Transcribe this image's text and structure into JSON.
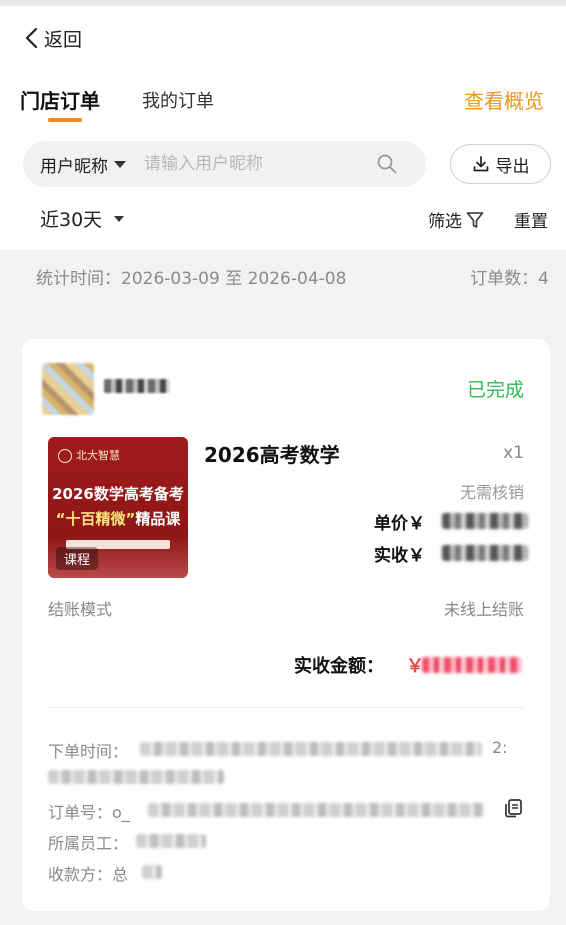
{
  "nav": {
    "back_label": "返回"
  },
  "tabs": {
    "store_orders": "门店订单",
    "my_orders": "我的订单",
    "overview": "查看概览"
  },
  "search": {
    "field_select": "用户昵称",
    "placeholder": "请输入用户昵称"
  },
  "toolbar": {
    "export_label": "导出",
    "date_range": "近30天",
    "filter_label": "筛选",
    "reset_label": "重置"
  },
  "stats": {
    "time_text": "统计时间：2026-03-09 至 2026-04-08",
    "count_text": "订单数：4"
  },
  "order": {
    "status": "已完成",
    "cover": {
      "publisher": "北大智慧",
      "line1": "2026数学高考备考",
      "line2_quote": "“十百精微”",
      "line2_rest": "精品课",
      "badge": "课程"
    },
    "product_title": "2026高考数学",
    "quantity": "x1",
    "verify_status": "无需核销",
    "unit_price_label": "单价￥",
    "paid_label": "实收￥",
    "checkout_mode_label": "结账模式",
    "checkout_mode_value": "未线上结账",
    "total_label": "实收金额：",
    "total_currency": "￥",
    "order_time_label": "下单时间：",
    "order_time_tail": "2:",
    "order_no_label": "订单号：o_",
    "staff_label": "所属员工：",
    "payee_label": "收款方：总"
  },
  "icons": {
    "back": "chevron-left-icon",
    "search": "search-icon",
    "export": "download-icon",
    "filter": "funnel-icon",
    "copy": "copy-icon"
  },
  "colors": {
    "accent": "#f28a1a",
    "success": "#2dbb58",
    "price": "#f04848"
  }
}
